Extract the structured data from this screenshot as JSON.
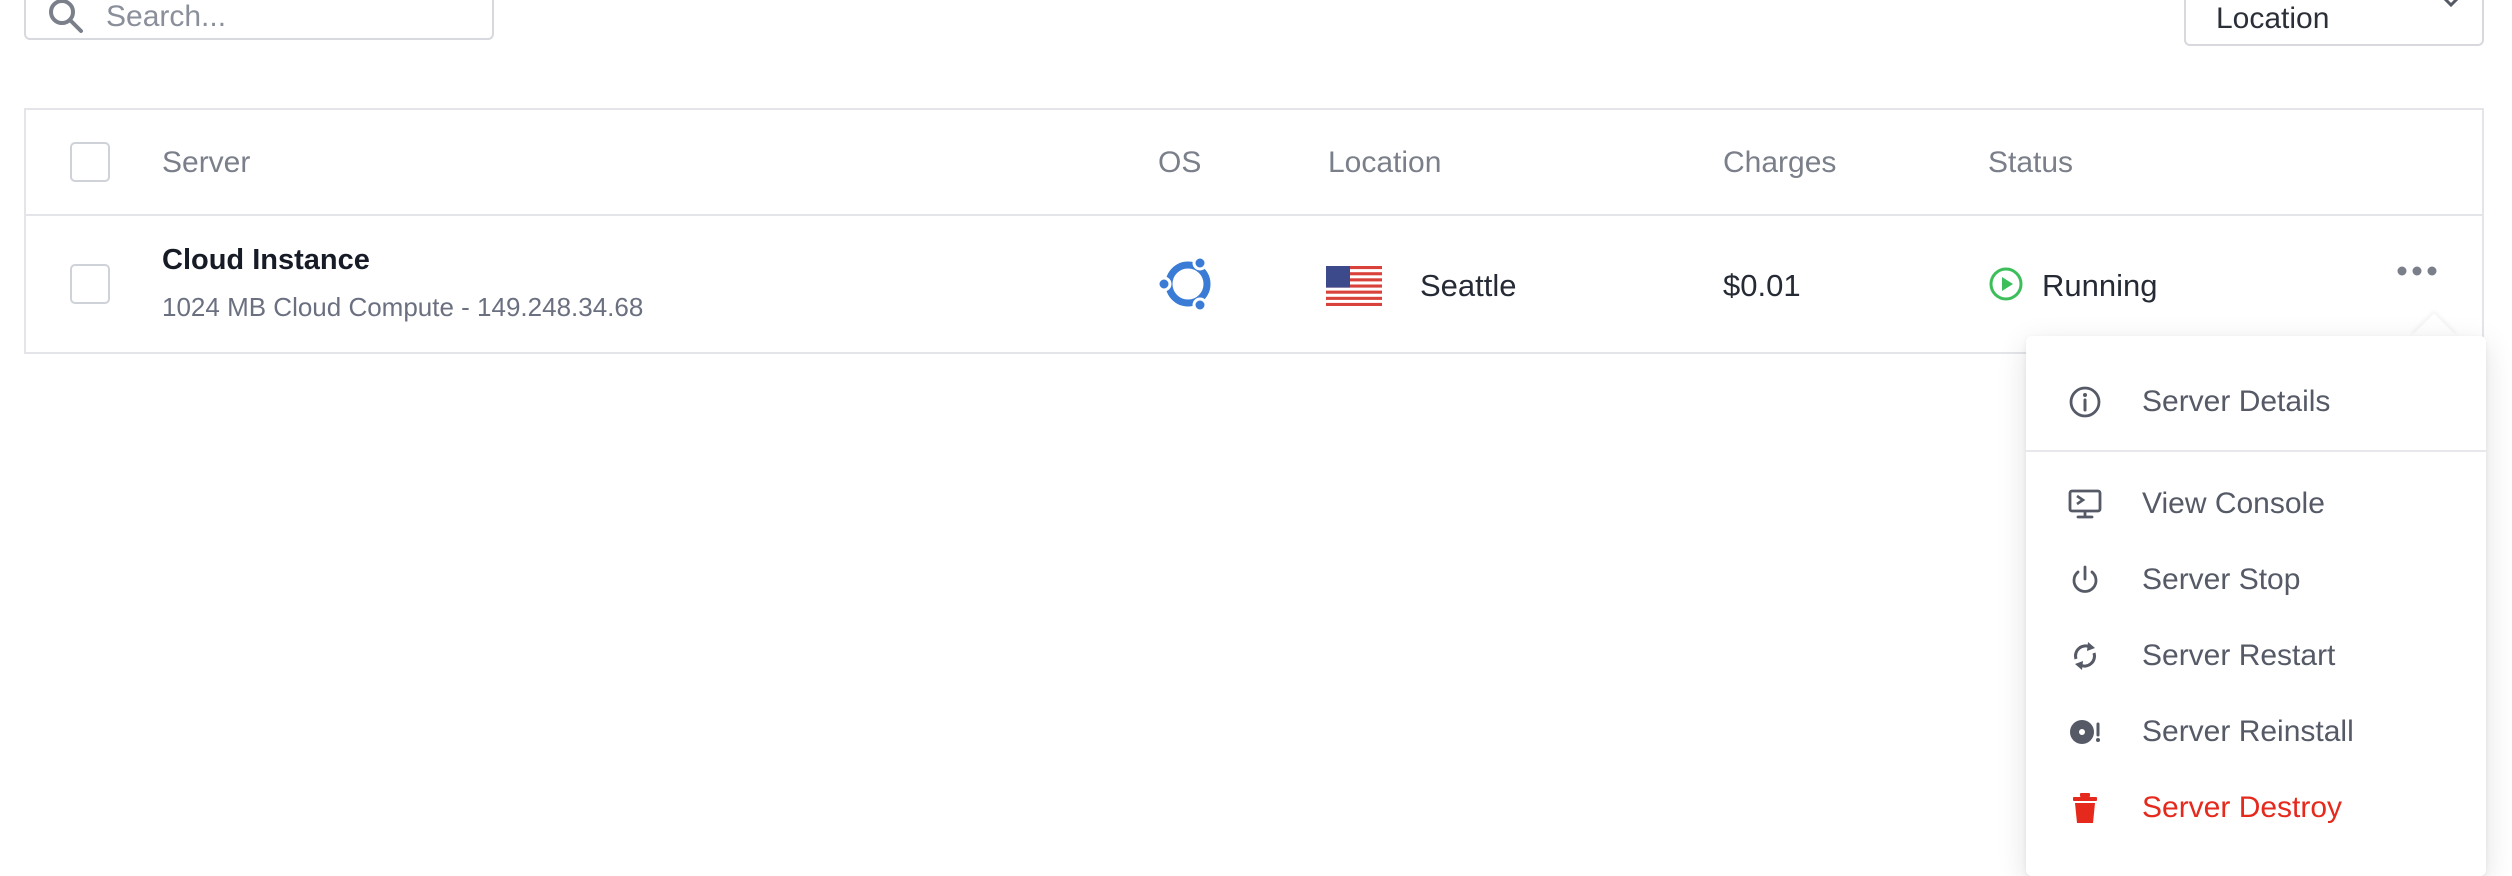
{
  "search": {
    "placeholder": "Search..."
  },
  "filters": {
    "location_label": "Location"
  },
  "table": {
    "columns": {
      "server": "Server",
      "os": "OS",
      "location": "Location",
      "charges": "Charges",
      "status": "Status"
    },
    "rows": [
      {
        "name": "Cloud Instance",
        "details": "1024 MB Cloud Compute - 149.248.34.68",
        "os_icon": "ubuntu-icon",
        "flag_icon": "us-flag-icon",
        "location": "Seattle",
        "charges": "$0.01",
        "status": "Running"
      }
    ]
  },
  "menu": {
    "items": [
      {
        "label": "Server Details",
        "icon": "info-icon"
      },
      {
        "label": "View Console",
        "icon": "console-icon"
      },
      {
        "label": "Server Stop",
        "icon": "power-icon"
      },
      {
        "label": "Server Restart",
        "icon": "restart-icon"
      },
      {
        "label": "Server Reinstall",
        "icon": "reinstall-icon"
      },
      {
        "label": "Server Destroy",
        "icon": "trash-icon"
      }
    ]
  },
  "colors": {
    "accent_blue": "#3a7bd5",
    "status_green": "#3cbf5a",
    "danger_red": "#e5291d"
  }
}
